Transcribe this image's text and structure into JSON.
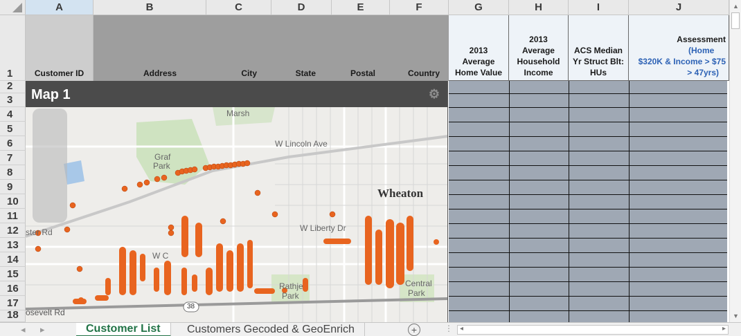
{
  "columns": [
    "A",
    "B",
    "C",
    "D",
    "E",
    "F",
    "G",
    "H",
    "I",
    "J"
  ],
  "rows": [
    "1",
    "2",
    "3",
    "4",
    "5",
    "6",
    "7",
    "8",
    "9",
    "10",
    "11",
    "12",
    "13",
    "14",
    "15",
    "16",
    "17",
    "18"
  ],
  "headers": {
    "customer_id": "Customer ID",
    "address": "Address",
    "city": "City",
    "state": "State",
    "postal": "Postal",
    "country": "Country",
    "g_line1": "2013",
    "g_line2": "Average",
    "g_line3": "Home Value",
    "h_line1": "2013",
    "h_line2": "Average",
    "h_line3": "Household",
    "h_line4": "Income",
    "i_line1": "ACS Median",
    "i_line2": "Yr Struct Blt:",
    "i_line3": "HUs",
    "j_line1_a": "Assessment ",
    "j_line1_b": "(Home",
    "j_line2": "$320K & Income > $75",
    "j_line3": "> 47yrs)"
  },
  "map": {
    "title": "Map 1",
    "labels": {
      "marsh": "Marsh",
      "lincoln": "W Lincoln Ave",
      "graf": "Graf",
      "park": "Park",
      "wheaton": "Wheaton",
      "liberty": "W Liberty Dr",
      "roosevelt": "osevelt Rd",
      "route": "38",
      "ster_rd": "ster Rd",
      "rathje": "Rathje",
      "park2": "Park",
      "central": "Central",
      "park3": "Park",
      "w_c": "W C"
    }
  },
  "tabs": [
    "Customer List",
    "Customers Gecoded & GeoEnrich"
  ],
  "add_tab_label": "+",
  "colors": {
    "accent": "#217346",
    "pin": "#e8641f",
    "header_gray": "#9e9e9e",
    "grid_fill": "#9fa8b4"
  }
}
